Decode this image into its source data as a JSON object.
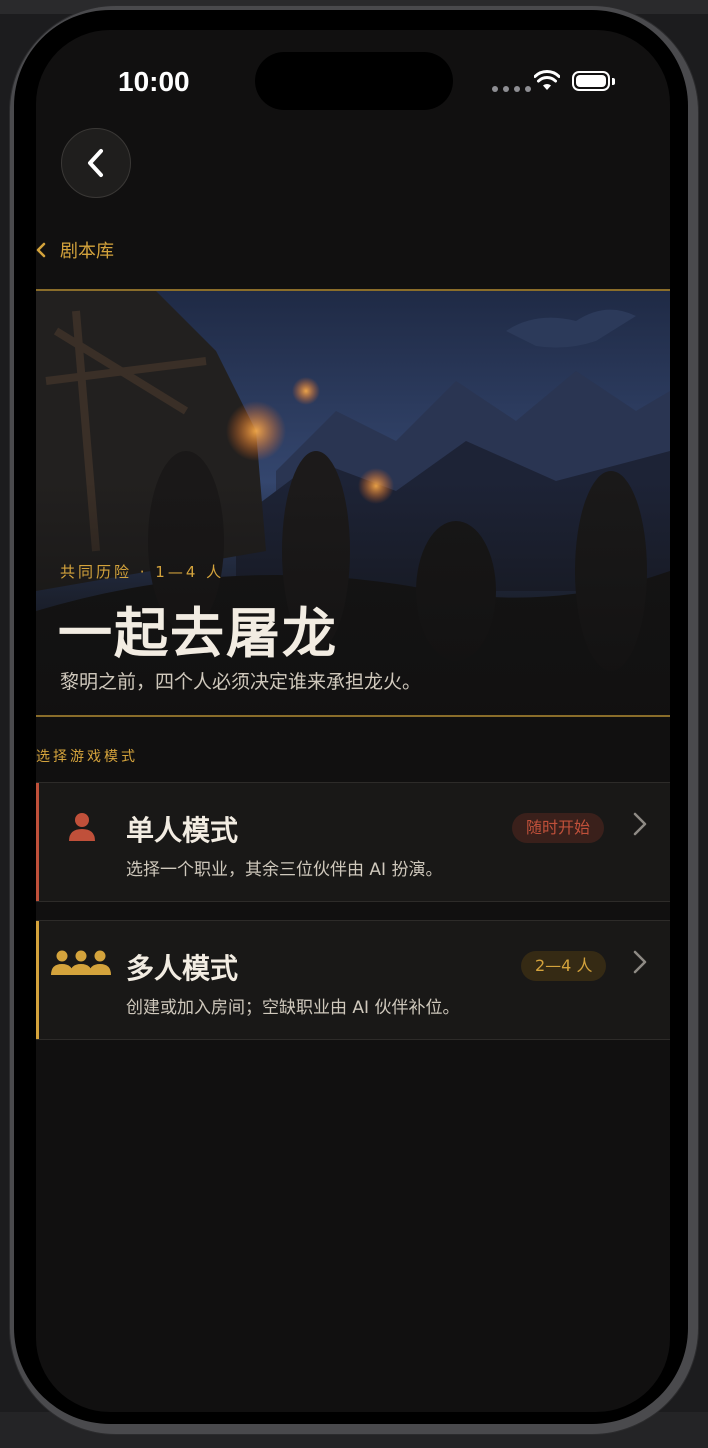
{
  "status_bar": {
    "time": "10:00"
  },
  "nav": {
    "breadcrumb_label": "剧本库"
  },
  "hero": {
    "tag": "共同历险 · 1—4 人",
    "title": "一起去屠龙",
    "subtitle": "黎明之前，四个人必须决定谁来承担龙火。"
  },
  "modes_section": {
    "title": "选择游戏模式",
    "modes": [
      {
        "title": "单人模式",
        "description": "选择一个职业，其余三位伙伴由 AI 扮演。",
        "badge": "随时开始",
        "icon": "single-person-icon",
        "accent_color": "#c0503a"
      },
      {
        "title": "多人模式",
        "description": "创建或加入房间；空缺职业由 AI 伙伴补位。",
        "badge": "2—4 人",
        "icon": "group-people-icon",
        "accent_color": "#d4a33c"
      }
    ]
  },
  "colors": {
    "accent_gold": "#d4a33c",
    "accent_red": "#c0503a",
    "background": "#111010"
  }
}
